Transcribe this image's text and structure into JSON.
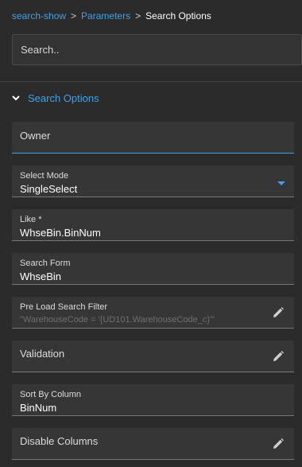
{
  "breadcrumb": {
    "items": [
      "search-show",
      "Parameters"
    ],
    "current": "Search Options"
  },
  "search": {
    "placeholder": "Search.."
  },
  "section": {
    "title": "Search Options",
    "icon": "chevron-down-icon"
  },
  "fields": {
    "owner": {
      "label": "Owner"
    },
    "select_mode": {
      "label": "Select Mode",
      "value": "SingleSelect"
    },
    "like": {
      "label": "Like *",
      "value": "WhseBin.BinNum"
    },
    "search_form": {
      "label": "Search Form",
      "value": "WhseBin"
    },
    "pre_load_filter": {
      "label": "Pre Load Search Filter",
      "value": "\"WarehouseCode = '{UD101.WarehouseCode_c}'\""
    },
    "validation": {
      "label": "Validation"
    },
    "sort_by": {
      "label": "Sort By Column",
      "value": "BinNum"
    },
    "disable_columns": {
      "label": "Disable Columns"
    }
  },
  "colors": {
    "accent": "#3fa1e8",
    "background": "#2b2b2b",
    "field": "#363636"
  }
}
